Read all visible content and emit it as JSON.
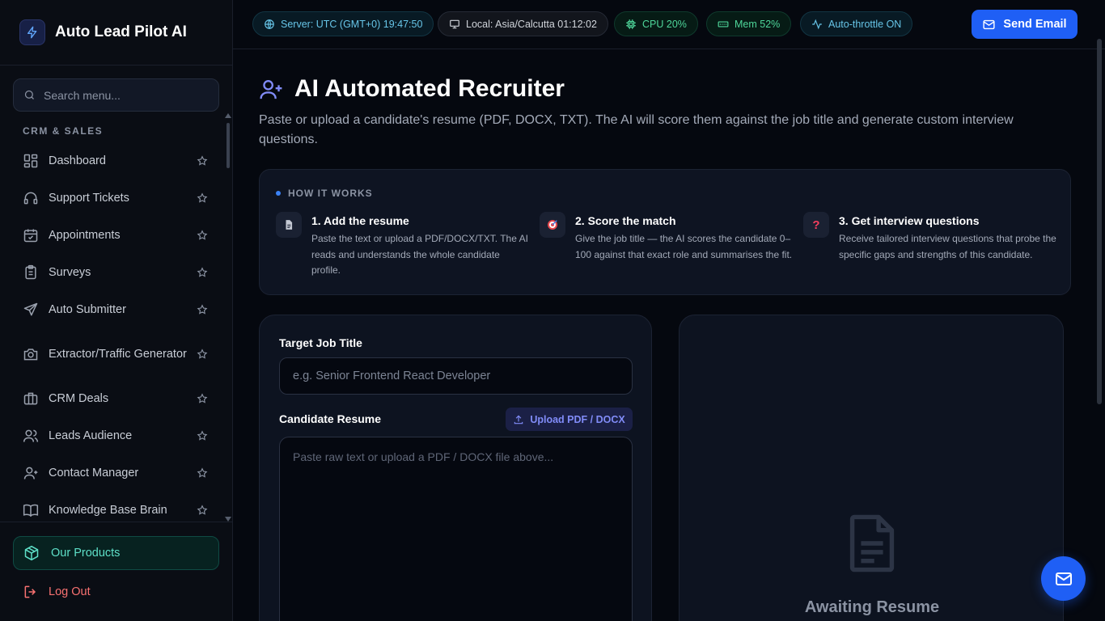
{
  "app": {
    "name": "Auto Lead Pilot AI"
  },
  "sidebar": {
    "search_placeholder": "Search menu...",
    "section_label": "CRM & SALES",
    "items": [
      {
        "label": "Dashboard",
        "icon": "grid-icon"
      },
      {
        "label": "Support Tickets",
        "icon": "headset-icon"
      },
      {
        "label": "Appointments",
        "icon": "calendar-check-icon"
      },
      {
        "label": "Surveys",
        "icon": "clipboard-icon"
      },
      {
        "label": "Auto Submitter",
        "icon": "send-icon"
      },
      {
        "label": "Extractor/Traffic Generator",
        "icon": "camera-icon"
      },
      {
        "label": "CRM Deals",
        "icon": "briefcase-icon"
      },
      {
        "label": "Leads Audience",
        "icon": "users-icon"
      },
      {
        "label": "Contact Manager",
        "icon": "user-group-icon"
      },
      {
        "label": "Knowledge Base Brain",
        "icon": "book-icon"
      }
    ],
    "products_label": "Our Products",
    "logout_label": "Log Out"
  },
  "topbar": {
    "server": "Server: UTC (GMT+0) 19:47:50",
    "local": "Local: Asia/Calcutta 01:12:02",
    "cpu": "CPU 20%",
    "mem": "Mem 52%",
    "throttle": "Auto-throttle ON",
    "send_email": "Send Email"
  },
  "main": {
    "title": "AI Automated Recruiter",
    "subtitle": "Paste or upload a candidate's resume (PDF, DOCX, TXT). The AI will score them against the job title and generate custom interview questions.",
    "how_label": "HOW IT WORKS",
    "steps": [
      {
        "title": "1. Add the resume",
        "desc": "Paste the text or upload a PDF/DOCX/TXT. The AI reads and understands the whole candidate profile.",
        "icon": "document-icon"
      },
      {
        "title": "2. Score the match",
        "desc": "Give the job title — the AI scores the candidate 0–100 against that exact role and summarises the fit.",
        "icon": "target-icon"
      },
      {
        "title": "3. Get interview questions",
        "desc": "Receive tailored interview questions that probe the specific gaps and strengths of this candidate.",
        "icon": "question-icon"
      }
    ],
    "job_label": "Target Job Title",
    "job_placeholder": "e.g. Senior Frontend React Developer",
    "resume_label": "Candidate Resume",
    "upload_label": "Upload PDF / DOCX",
    "resume_placeholder": "Paste raw text or upload a PDF / DOCX file above...",
    "awaiting": "Awaiting Resume"
  },
  "colors": {
    "accent": "#1f5ff5",
    "teal": "#5ee0c8",
    "danger": "#f87171",
    "indigo": "#818cf8"
  }
}
